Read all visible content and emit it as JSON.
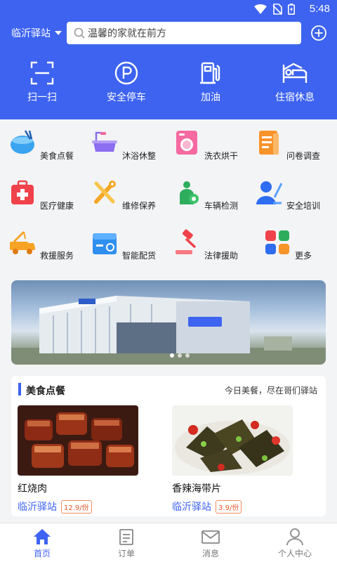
{
  "status_bar": {
    "time": "5:48"
  },
  "header": {
    "city": "临沂驿站",
    "search_placeholder": "温馨的家就在前方"
  },
  "quick_actions": [
    {
      "label": "扫一扫",
      "icon": "scan-icon"
    },
    {
      "label": "安全停车",
      "icon": "parking-icon"
    },
    {
      "label": "加油",
      "icon": "fuel-icon"
    },
    {
      "label": "住宿休息",
      "icon": "bed-icon"
    }
  ],
  "services": [
    {
      "label": "美食点餐",
      "icon": "food-bowl-icon"
    },
    {
      "label": "沐浴休整",
      "icon": "bathtub-icon"
    },
    {
      "label": "洗衣烘干",
      "icon": "washing-machine-icon"
    },
    {
      "label": "问卷调查",
      "icon": "survey-icon"
    },
    {
      "label": "医疗健康",
      "icon": "medical-kit-icon"
    },
    {
      "label": "维修保养",
      "icon": "repair-tools-icon"
    },
    {
      "label": "车辆检测",
      "icon": "vehicle-check-icon"
    },
    {
      "label": "安全培训",
      "icon": "training-icon"
    },
    {
      "label": "救援服务",
      "icon": "tow-truck-icon"
    },
    {
      "label": "智能配货",
      "icon": "cargo-box-icon"
    },
    {
      "label": "法律援助",
      "icon": "gavel-icon"
    },
    {
      "label": "更多",
      "icon": "more-grid-icon"
    }
  ],
  "banner": {
    "slide_count": 3,
    "active_slide": 1
  },
  "food_section": {
    "title": "美食点餐",
    "subtitle": "今日美餐，尽在哥们驿站",
    "items": [
      {
        "name": "红烧肉",
        "station": "临沂驿站",
        "price": "12.9/份"
      },
      {
        "name": "香辣海带片",
        "station": "临沂驿站",
        "price": "3.9/份"
      }
    ]
  },
  "tabs": [
    {
      "label": "首页",
      "icon": "home-icon",
      "active": true
    },
    {
      "label": "订单",
      "icon": "order-icon",
      "active": false
    },
    {
      "label": "消息",
      "icon": "message-icon",
      "active": false
    },
    {
      "label": "个人中心",
      "icon": "profile-icon",
      "active": false
    }
  ],
  "colors": {
    "primary": "#3d63f0",
    "price_tag": "#e5582a"
  }
}
